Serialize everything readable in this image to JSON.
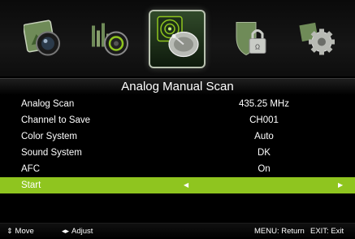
{
  "header": {
    "categories": [
      {
        "name": "picture",
        "icon": "picture-icon"
      },
      {
        "name": "sound",
        "icon": "sound-icon"
      },
      {
        "name": "channel",
        "icon": "satellite-dish-icon",
        "selected": true
      },
      {
        "name": "lock",
        "icon": "lock-icon"
      },
      {
        "name": "setup",
        "icon": "gear-icon"
      }
    ],
    "accent_color": "#8fc51f"
  },
  "page_title": "Analog Manual Scan",
  "menu": {
    "items": [
      {
        "label": "Analog Scan",
        "value": "435.25 MHz"
      },
      {
        "label": "Channel to Save",
        "value": "CH001"
      },
      {
        "label": "Color System",
        "value": "Auto"
      },
      {
        "label": "Sound System",
        "value": "DK"
      },
      {
        "label": "AFC",
        "value": "On"
      },
      {
        "label": "Start",
        "value": "",
        "highlighted": true
      }
    ]
  },
  "footer": {
    "move_icon": "updown-arrows-icon",
    "move_label": "Move",
    "adjust_icon": "leftright-arrows-icon",
    "adjust_label": "Adjust",
    "return_label": "MENU: Return",
    "exit_label": "EXIT: Exit"
  }
}
